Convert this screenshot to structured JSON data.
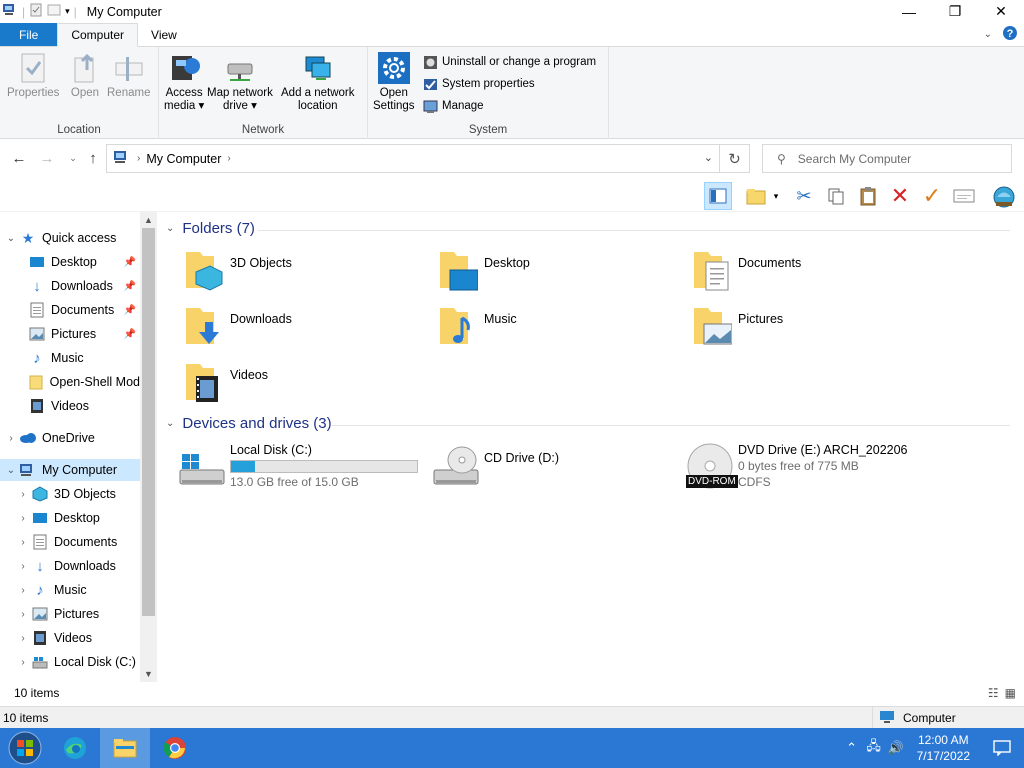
{
  "window": {
    "title": "My Computer"
  },
  "ribbon_tabs": {
    "file": "File",
    "computer": "Computer",
    "view": "View"
  },
  "ribbon": {
    "location": {
      "label": "Location",
      "properties": "Properties",
      "open": "Open",
      "rename": "Rename"
    },
    "network": {
      "label": "Network",
      "access_media_1": "Access",
      "access_media_2": "media",
      "map_drive_1": "Map network",
      "map_drive_2": "drive",
      "add_location_1": "Add a network",
      "add_location_2": "location"
    },
    "system": {
      "label": "System",
      "open_settings_1": "Open",
      "open_settings_2": "Settings",
      "uninstall": "Uninstall or change a program",
      "properties": "System properties",
      "manage": "Manage"
    }
  },
  "address": {
    "location": "My Computer",
    "search_placeholder": "Search My Computer"
  },
  "navpane": {
    "quick_access": "Quick access",
    "qa_items": [
      "Desktop",
      "Downloads",
      "Documents",
      "Pictures",
      "Music",
      "Open-Shell Mod",
      "Videos"
    ],
    "onedrive": "OneDrive",
    "my_computer": "My Computer",
    "pc_items": [
      "3D Objects",
      "Desktop",
      "Documents",
      "Downloads",
      "Music",
      "Pictures",
      "Videos",
      "Local Disk (C:)"
    ]
  },
  "content": {
    "folders_header": "Folders (7)",
    "folders": [
      "3D Objects",
      "Desktop",
      "Documents",
      "Downloads",
      "Music",
      "Pictures",
      "Videos"
    ],
    "drives_header": "Devices and drives (3)",
    "drives": [
      {
        "name": "Local Disk (C:)",
        "free": "13.0 GB free of 15.0 GB",
        "used_fraction": 0.13
      },
      {
        "name": "CD Drive (D:)"
      },
      {
        "name": "DVD Drive (E:) ARCH_202206",
        "free": "0 bytes free of 775 MB",
        "fs": "CDFS",
        "badge": "DVD-ROM"
      }
    ]
  },
  "status": {
    "items_count": "10 items",
    "items_count2": "10 items",
    "location": "Computer"
  },
  "taskbar": {
    "time": "12:00 AM",
    "date": "7/17/2022"
  },
  "colors": {
    "accent": "#1979ca",
    "taskbar": "#2b78d4",
    "selection": "#cce8ff",
    "section_header": "#1e3287"
  }
}
